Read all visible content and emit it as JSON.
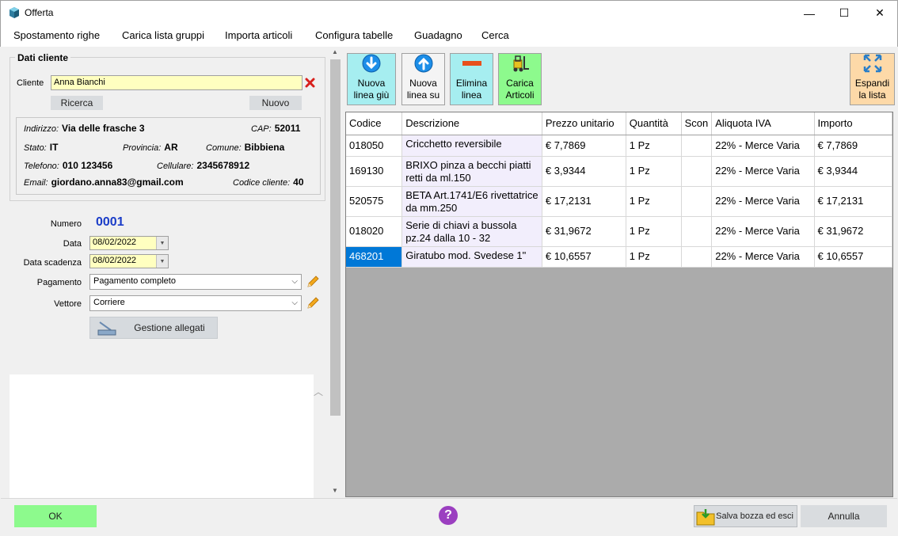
{
  "window": {
    "title": "Offerta",
    "minimize": "—",
    "maximize": "☐",
    "close": "✕"
  },
  "menu": [
    "Spostamento righe",
    "Carica lista gruppi",
    "Importa articoli",
    "Configura tabelle",
    "Guadagno",
    "Cerca"
  ],
  "cliente": {
    "group_title": "Dati cliente",
    "label": "Cliente",
    "value": "Anna Bianchi",
    "ricerca": "Ricerca",
    "nuovo": "Nuovo",
    "indirizzo_label": "Indirizzo:",
    "indirizzo": "Via delle frasche 3",
    "cap_label": "CAP:",
    "cap": "52011",
    "stato_label": "Stato:",
    "stato": "IT",
    "provincia_label": "Provincia:",
    "provincia": "AR",
    "comune_label": "Comune:",
    "comune": "Bibbiena",
    "telefono_label": "Telefono:",
    "telefono": "010 123456",
    "cellulare_label": "Cellulare:",
    "cellulare": "2345678912",
    "email_label": "Email:",
    "email": "giordano.anna83@gmail.com",
    "codice_label": "Codice cliente:",
    "codice": "40"
  },
  "form": {
    "numero_label": "Numero",
    "numero": "0001",
    "data_label": "Data",
    "data": "08/02/2022",
    "scadenza_label": "Data scadenza",
    "scadenza": "08/02/2022",
    "pagamento_label": "Pagamento",
    "pagamento": "Pagamento completo",
    "vettore_label": "Vettore",
    "vettore": "Corriere",
    "allegati": "Gestione allegati"
  },
  "toolbar": {
    "nuova_giu_1": "Nuova",
    "nuova_giu_2": "linea giù",
    "nuova_su_1": "Nuova",
    "nuova_su_2": "linea su",
    "elimina_1": "Elimina",
    "elimina_2": "linea",
    "carica_1": "Carica",
    "carica_2": "Articoli",
    "espandi_1": "Espandi",
    "espandi_2": "la lista"
  },
  "table": {
    "headers": [
      "Codice",
      "Descrizione",
      "Prezzo unitario",
      "Quantità",
      "Scon",
      "Aliquota IVA",
      "Importo"
    ],
    "rows": [
      [
        "018050",
        "Cricchetto reversibile",
        "€ 7,7869",
        "1 Pz",
        "",
        "22% - Merce Varia",
        "€ 7,7869"
      ],
      [
        "169130",
        "BRIXO pinza a becchi piatti retti da ml.150",
        "€ 3,9344",
        "1 Pz",
        "",
        "22% - Merce Varia",
        "€ 3,9344"
      ],
      [
        "520575",
        "BETA Art.1741/E6 rivettatrice da mm.250",
        "€ 17,2131",
        "1 Pz",
        "",
        "22% - Merce Varia",
        "€ 17,2131"
      ],
      [
        "018020",
        "Serie di chiavi a bussola pz.24 dalla 10 - 32",
        "€ 31,9672",
        "1 Pz",
        "",
        "22% - Merce Varia",
        "€ 31,9672"
      ],
      [
        "468201",
        "Giratubo mod. Svedese 1\"",
        "€ 10,6557",
        "1 Pz",
        "",
        "22% - Merce Varia",
        "€ 10,6557"
      ]
    ]
  },
  "footer": {
    "ok": "OK",
    "help": "?",
    "salva": "Salva bozza ed esci",
    "annulla": "Annulla"
  },
  "colors": {
    "accent_blue": "#0078d7",
    "cyan_button": "#a6eef0",
    "green_button": "#8dfa8d",
    "orange_button": "#fdd9a8"
  }
}
